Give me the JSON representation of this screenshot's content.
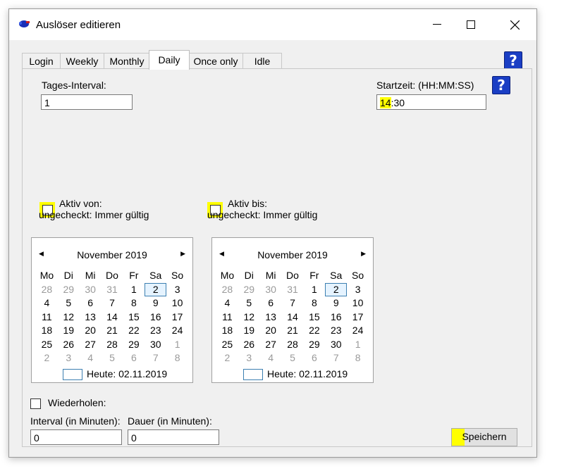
{
  "window": {
    "title": "Auslöser editieren"
  },
  "tabs": [
    "Login",
    "Weekly",
    "Monthly",
    "Daily",
    "Once only",
    "Idle"
  ],
  "daily": {
    "interval_label": "Tages-Interval:",
    "interval_value": "1",
    "start_label": "Startzeit: (HH:MM:SS)",
    "start_hours": "14",
    "start_rest": ":30"
  },
  "active_from": {
    "label_line1": "Aktiv von:",
    "label_line2": "ungecheckt: Immer gültig"
  },
  "active_to": {
    "label_line1": "Aktiv bis:",
    "label_line2": "ungecheckt: Immer gültig"
  },
  "calendar": {
    "month": "November 2019",
    "weekdays": [
      "Mo",
      "Di",
      "Mi",
      "Do",
      "Fr",
      "Sa",
      "So"
    ],
    "weeks": [
      [
        [
          "28",
          1
        ],
        [
          "29",
          1
        ],
        [
          "30",
          1
        ],
        [
          "31",
          1
        ],
        [
          "1",
          0
        ],
        [
          "2",
          2
        ],
        [
          "3",
          0
        ]
      ],
      [
        [
          "4",
          0
        ],
        [
          "5",
          0
        ],
        [
          "6",
          0
        ],
        [
          "7",
          0
        ],
        [
          "8",
          0
        ],
        [
          "9",
          0
        ],
        [
          "10",
          0
        ]
      ],
      [
        [
          "11",
          0
        ],
        [
          "12",
          0
        ],
        [
          "13",
          0
        ],
        [
          "14",
          0
        ],
        [
          "15",
          0
        ],
        [
          "16",
          0
        ],
        [
          "17",
          0
        ]
      ],
      [
        [
          "18",
          0
        ],
        [
          "19",
          0
        ],
        [
          "20",
          0
        ],
        [
          "21",
          0
        ],
        [
          "22",
          0
        ],
        [
          "23",
          0
        ],
        [
          "24",
          0
        ]
      ],
      [
        [
          "25",
          0
        ],
        [
          "26",
          0
        ],
        [
          "27",
          0
        ],
        [
          "28",
          0
        ],
        [
          "29",
          0
        ],
        [
          "30",
          0
        ],
        [
          "1",
          1
        ]
      ],
      [
        [
          "2",
          1
        ],
        [
          "3",
          1
        ],
        [
          "4",
          1
        ],
        [
          "5",
          1
        ],
        [
          "6",
          1
        ],
        [
          "7",
          1
        ],
        [
          "8",
          1
        ]
      ]
    ],
    "today_label": "Heute: 02.11.2019"
  },
  "repeat": {
    "checkbox_label": "Wiederholen:",
    "interval_label": "Interval (in Minuten):",
    "interval_value": "0",
    "duration_label": "Dauer (in Minuten):",
    "duration_value": "0"
  },
  "save_button": {
    "label_first": "Sp",
    "label_rest": "eichern"
  },
  "help_label": "?",
  "colors": {
    "highlight": "#ffff00",
    "help_blue": "#1a3ec4",
    "today_border": "#3c7fb1"
  }
}
